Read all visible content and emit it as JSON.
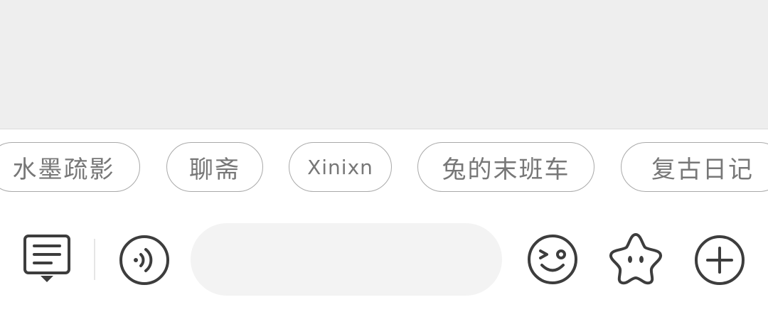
{
  "chips": [
    {
      "label": "水墨疏影"
    },
    {
      "label": "聊斋"
    },
    {
      "label": "Xinixn"
    },
    {
      "label": "兔的末班车"
    },
    {
      "label": "复古日记"
    }
  ],
  "input": {
    "value": "",
    "placeholder": ""
  },
  "icons": {
    "menu": "message-menu-icon",
    "voice": "voice-icon",
    "emoji": "emoji-icon",
    "star": "star-face-icon",
    "plus": "plus-icon"
  },
  "colors": {
    "icon": "#3d3d3d",
    "chip_text": "#777777",
    "chip_border": "#a9a9a9",
    "chat_bg": "#eeeeee",
    "input_bg": "#f3f3f3"
  }
}
